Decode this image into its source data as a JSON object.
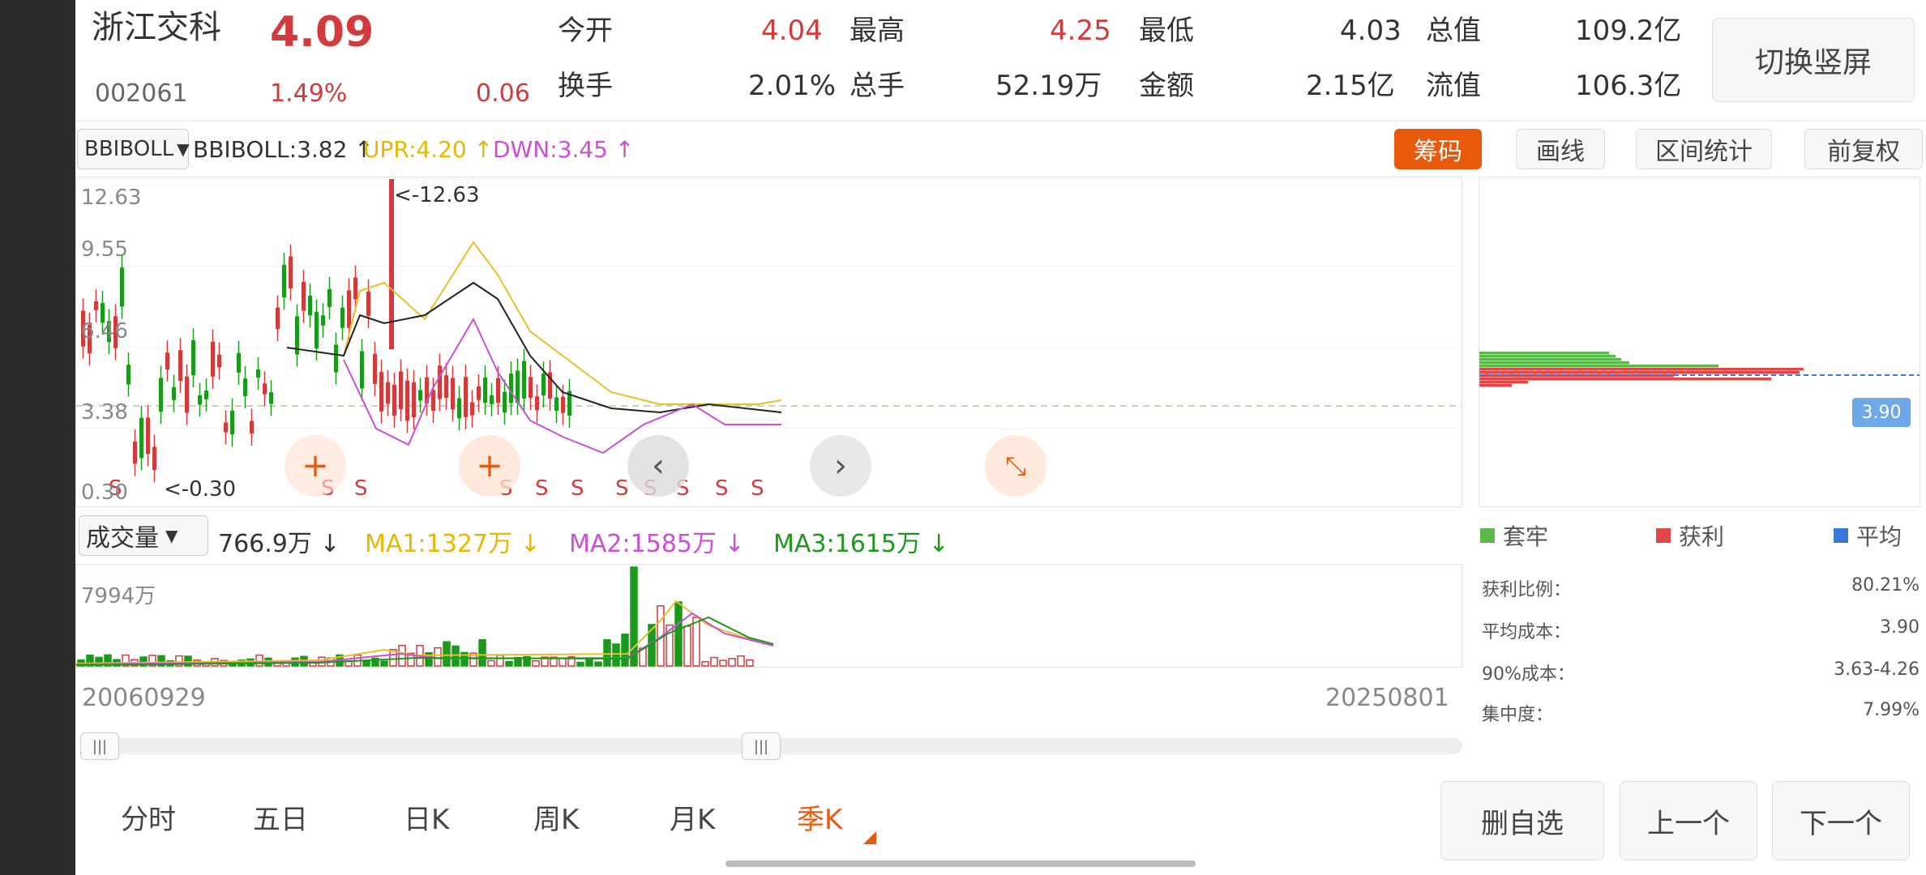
{
  "stock": {
    "name": "浙江交科",
    "code": "002061",
    "price": "4.09",
    "change_pct": "1.49%",
    "change": "0.06"
  },
  "quote": {
    "open_label": "今开",
    "open": "4.04",
    "high_label": "最高",
    "high": "4.25",
    "low_label": "最低",
    "low": "4.03",
    "mcap_label": "总值",
    "mcap": "109.2亿",
    "turnover_label": "换手",
    "turnover": "2.01%",
    "vol_label": "总手",
    "vol": "52.19万",
    "amount_label": "金额",
    "amount": "2.15亿",
    "float_label": "流值",
    "float": "106.3亿"
  },
  "switch_button": "切换竖屏",
  "indicator": {
    "selected": "BBIBOLL",
    "bbiboll": "BBIBOLL:3.82 ↑",
    "upr": "UPR:4.20 ↑",
    "dwn": "DWN:3.45 ↑"
  },
  "tools": {
    "chips": "筹码",
    "draw": "画线",
    "range_stats": "区间统计",
    "adjust": "前复权"
  },
  "main_chart": {
    "y_labels": [
      "12.63",
      "9.55",
      "6.46",
      "3.38",
      "0.30"
    ],
    "max_annot": "<-12.63",
    "min_annot": "<-0.30",
    "s_markers": [
      "S",
      "S",
      "S",
      "S",
      "S",
      "S",
      "S",
      "S",
      "S",
      "S",
      "S"
    ]
  },
  "volume": {
    "selected": "成交量",
    "vol": "766.9万 ↓",
    "ma1": "MA1:1327万 ↓",
    "ma2": "MA2:1585万 ↓",
    "ma3": "MA3:1615万 ↓",
    "y_label": "7994万"
  },
  "dates": {
    "start": "20060929",
    "end": "20250801"
  },
  "chip_panel": {
    "price_tag": "3.90",
    "legend": {
      "trapped": "套牢",
      "profit": "获利",
      "average": "平均"
    },
    "stats": [
      {
        "label": "获利比例：",
        "value": "80.21%"
      },
      {
        "label": "平均成本：",
        "value": "3.90"
      },
      {
        "label": "90%成本：",
        "value": "3.63-4.26"
      },
      {
        "label": "集中度：",
        "value": "7.99%"
      }
    ]
  },
  "tabs": [
    "分时",
    "五日",
    "日K",
    "周K",
    "月K",
    "季K"
  ],
  "bottom_buttons": {
    "remove": "删自选",
    "prev": "上一个",
    "next": "下一个"
  },
  "colors": {
    "up": "#d13b3b",
    "down": "#1a9a1a",
    "accent": "#e8590c",
    "ma_yellow": "#e6c02a",
    "ma_purple": "#c94fd6",
    "mid_black": "#222"
  },
  "icons": {
    "zoom_in": "plus-icon",
    "prev": "chevron-left-icon",
    "next": "chevron-right-icon",
    "collapse": "compress-icon"
  }
}
